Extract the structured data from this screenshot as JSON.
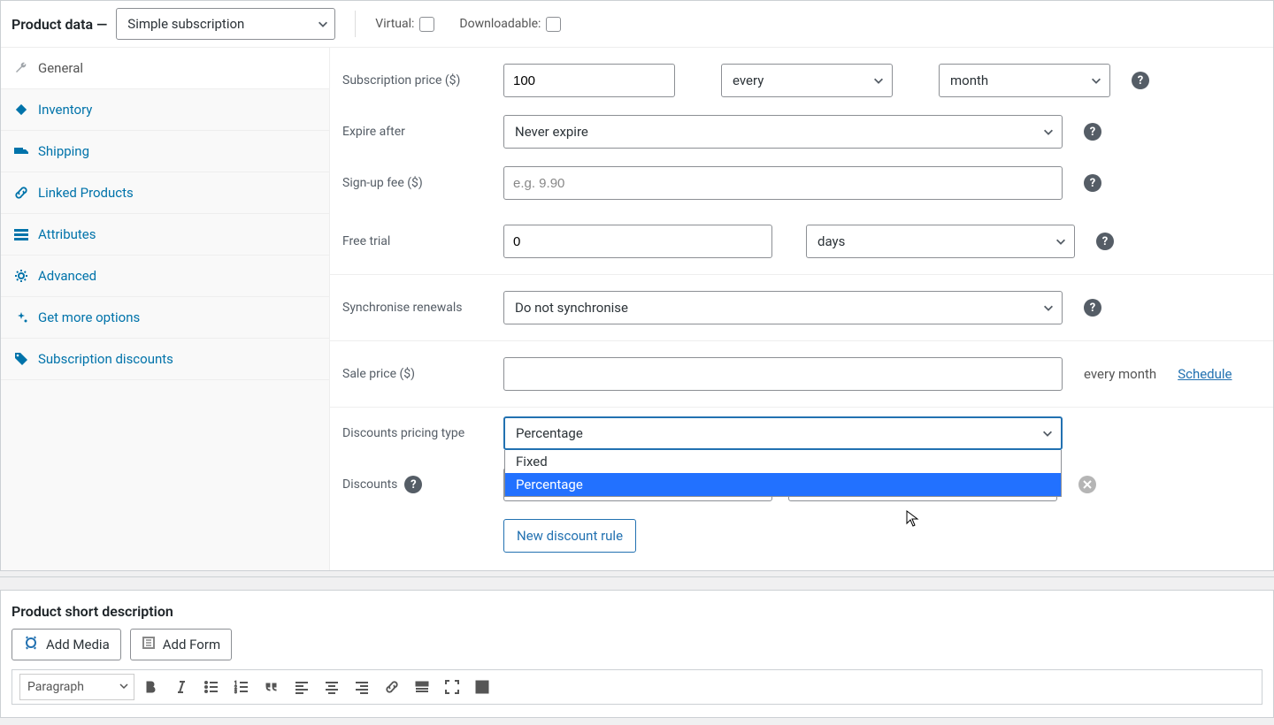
{
  "header": {
    "title": "Product data —",
    "product_type_select": "Simple subscription",
    "virtual_label": "Virtual:",
    "downloadable_label": "Downloadable:"
  },
  "sidebar": {
    "items": [
      {
        "label": "General",
        "icon": "wrench"
      },
      {
        "label": "Inventory",
        "icon": "diamond"
      },
      {
        "label": "Shipping",
        "icon": "truck"
      },
      {
        "label": "Linked Products",
        "icon": "link"
      },
      {
        "label": "Attributes",
        "icon": "list"
      },
      {
        "label": "Advanced",
        "icon": "gear"
      },
      {
        "label": "Get more options",
        "icon": "getmore"
      },
      {
        "label": "Subscription discounts",
        "icon": "tag"
      }
    ]
  },
  "form": {
    "sub_price_label": "Subscription price ($)",
    "sub_price_value": "100",
    "sub_period_every": "every",
    "sub_period_unit": "month",
    "expire_label": "Expire after",
    "expire_value": "Never expire",
    "signup_label": "Sign-up fee ($)",
    "signup_placeholder": "e.g. 9.90",
    "trial_label": "Free trial",
    "trial_value": "0",
    "trial_unit": "days",
    "sync_label": "Synchronise renewals",
    "sync_value": "Do not synchronise",
    "sale_label": "Sale price ($)",
    "sale_value": "",
    "sale_after": "every month",
    "schedule_link": "Schedule",
    "pricing_type_label": "Discounts pricing type",
    "pricing_type_value": "Percentage",
    "pricing_options": [
      "Fixed",
      "Percentage"
    ],
    "discounts_label": "Discounts",
    "new_rule_btn": "New discount rule"
  },
  "desc": {
    "title": "Product short description",
    "add_media": "Add Media",
    "add_form": "Add Form",
    "paragraph": "Paragraph"
  }
}
